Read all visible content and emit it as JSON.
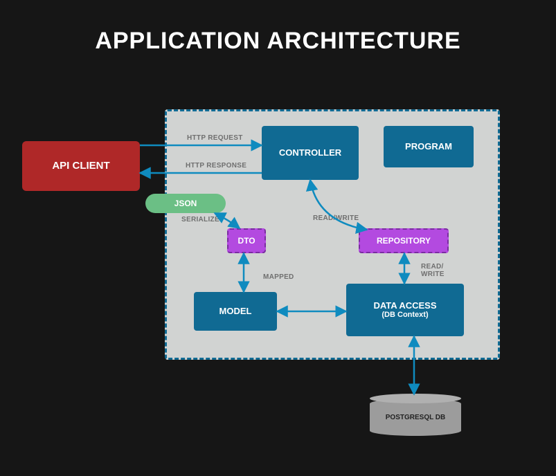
{
  "title": "APPLICATION ARCHITECTURE",
  "nodes": {
    "api_client": "API CLIENT",
    "controller": "CONTROLLER",
    "program": "PROGRAM",
    "json": "JSON",
    "dto": "DTO",
    "repository": "REPOSITORY",
    "model": "MODEL",
    "data_access": "DATA ACCESS",
    "data_access_sub": "(DB Context)",
    "postgresql_db": "POSTGRESQL DB"
  },
  "edges": {
    "http_request": "HTTP REQUEST",
    "http_response": "HTTP RESPONSE",
    "serialize": "SERIALIZE",
    "read_write_1": "READ/WRITE",
    "mapped": "MAPPED",
    "read_write_2": "READ/\nWRITE"
  },
  "colors": {
    "bg": "#161616",
    "container": "#d1d3d2",
    "dash_border": "#106a93",
    "blue": "#106a93",
    "red": "#af2828",
    "green": "#6bbf85",
    "purple": "#b34ae0",
    "gray": "#9c9c9c",
    "arrow": "#0f8bbf"
  }
}
